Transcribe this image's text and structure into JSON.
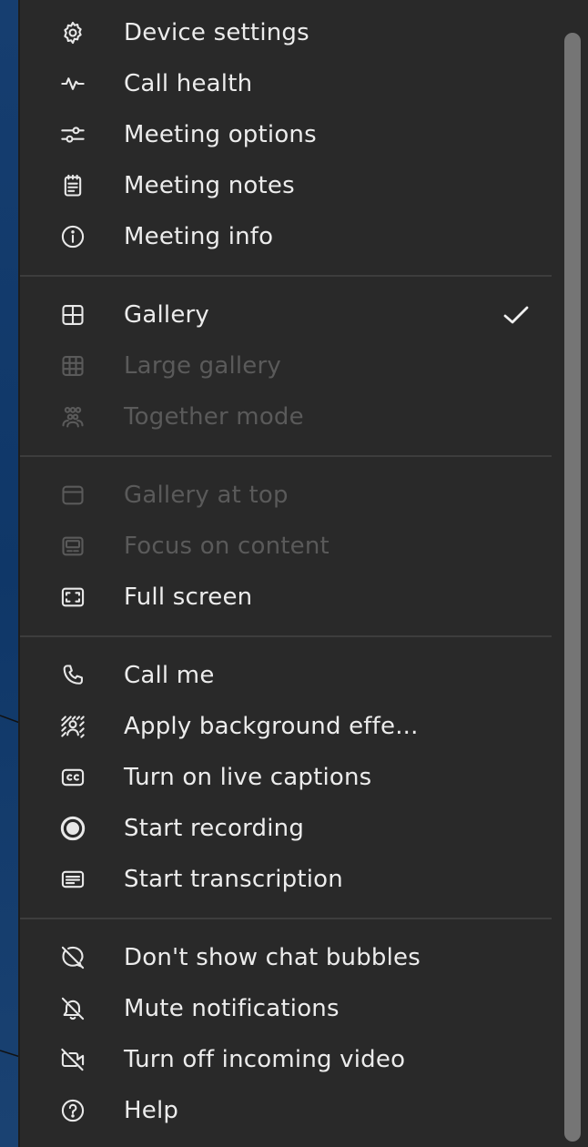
{
  "menu": {
    "group_view_options": [
      {
        "label": "Device settings",
        "icon": "gear-icon"
      },
      {
        "label": "Call health",
        "icon": "pulse-icon"
      },
      {
        "label": "Meeting options",
        "icon": "sliders-icon"
      },
      {
        "label": "Meeting notes",
        "icon": "notes-icon"
      },
      {
        "label": "Meeting info",
        "icon": "info-icon"
      }
    ],
    "group_layout": [
      {
        "label": "Gallery",
        "icon": "grid-2x2-icon",
        "selected": true
      },
      {
        "label": "Large gallery",
        "icon": "grid-3x3-icon",
        "disabled": true
      },
      {
        "label": "Together mode",
        "icon": "people-group-icon",
        "disabled": true
      }
    ],
    "group_display": [
      {
        "label": "Gallery at top",
        "icon": "panel-top-icon",
        "disabled": true
      },
      {
        "label": "Focus on content",
        "icon": "content-focus-icon",
        "disabled": true
      },
      {
        "label": "Full screen",
        "icon": "fullscreen-icon"
      }
    ],
    "group_actions": [
      {
        "label": "Call me",
        "icon": "phone-icon"
      },
      {
        "label": "Apply background effe...",
        "icon": "background-effects-icon"
      },
      {
        "label": "Turn on live captions",
        "icon": "captions-icon"
      },
      {
        "label": "Start recording",
        "icon": "record-icon"
      },
      {
        "label": "Start transcription",
        "icon": "transcript-icon"
      }
    ],
    "group_misc": [
      {
        "label": "Don't show chat bubbles",
        "icon": "chat-off-icon"
      },
      {
        "label": "Mute notifications",
        "icon": "bell-off-icon"
      },
      {
        "label": "Turn off incoming video",
        "icon": "video-off-icon"
      },
      {
        "label": "Help",
        "icon": "help-icon"
      }
    ]
  },
  "colors": {
    "menu_bg": "#292929",
    "text": "#ececec",
    "disabled_text": "#5a5a5a",
    "divider": "#3d3d3d",
    "scrollbar": "#757575",
    "desktop_bg": "#0c3a6e"
  }
}
